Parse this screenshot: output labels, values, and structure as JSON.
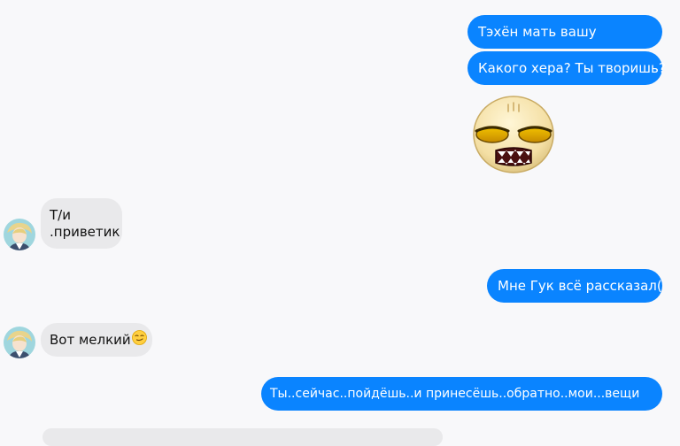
{
  "chat": {
    "messages": [
      {
        "side": "out",
        "text": "Тэхён мать вашу"
      },
      {
        "side": "out",
        "text": "Какого хера? Ты творишь?"
      },
      {
        "side": "out",
        "type": "sticker",
        "sticker": "grumpy-face-sticker"
      },
      {
        "side": "in",
        "line1": "Т/и",
        "line2": ".приветик"
      },
      {
        "side": "out",
        "text": "Мне Гук всё рассказал("
      },
      {
        "side": "in",
        "text": "Вот мелкий",
        "emoji": "smirk-emoji"
      },
      {
        "side": "out",
        "text": "Ты..сейчас..пойдёшь..и принесёшь..обратно..мои...вещи"
      }
    ]
  },
  "colors": {
    "outgoing_bubble": "#0a84ff",
    "incoming_bubble": "#e9e9eb",
    "background": "#f8f8fa"
  }
}
